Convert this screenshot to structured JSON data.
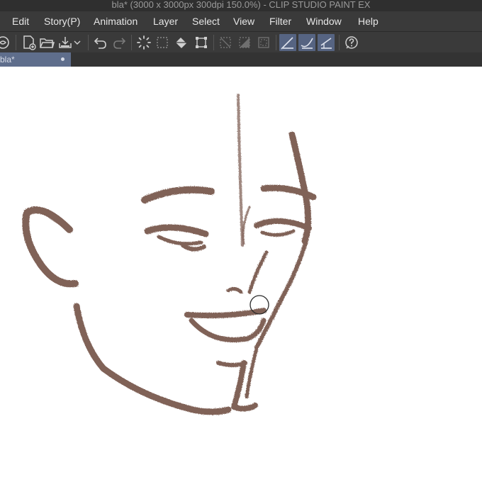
{
  "window": {
    "title": "bla* (3000 x 3000px 300dpi 150.0%)  - CLIP STUDIO PAINT EX"
  },
  "menubar": {
    "items": [
      "Edit",
      "Story(P)",
      "Animation",
      "Layer",
      "Select",
      "View",
      "Filter",
      "Window",
      "Help"
    ]
  },
  "toolbar": {
    "icons": [
      "layers-partial-icon",
      "new-canvas-icon",
      "open-folder-icon",
      "save-icon",
      "dropdown-chevron-icon",
      "undo-icon",
      "redo-icon",
      "loading-spinner-icon",
      "selection-dashed-icon",
      "fill-bucket-icon",
      "transform-icon",
      "deselect-icon",
      "invert-selection-icon",
      "selection-border-icon",
      "snap-ruler-icon",
      "snap-curve-icon",
      "snap-grid-icon",
      "help-icon"
    ],
    "active_icons": [
      "snap-ruler-icon",
      "snap-curve-icon",
      "snap-grid-icon"
    ]
  },
  "document_tab": {
    "label": "bla*"
  },
  "canvas": {
    "background": "#ffffff",
    "stroke_color": "#7a5a50"
  },
  "colors": {
    "titlebar_bg": "#2f2f2f",
    "menubar_bg": "#3a3a3a",
    "tab_active_bg": "#5f6e8c",
    "toolbar_active_bg": "#566482"
  }
}
